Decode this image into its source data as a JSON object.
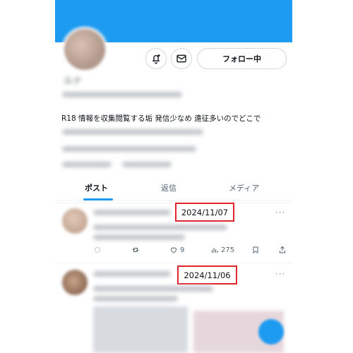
{
  "profile": {
    "display_name": "ルナ",
    "handle": "@lunaxxxx · Joined January 2020",
    "bio_line1": "R18 情報を収集閲覧する垢 発信少なめ 遠征多いのでどこで",
    "bio_line2": "もいるかも 気軽にどうぞ",
    "follow_label": "フォロー中"
  },
  "icons": {
    "notify": "bell-plus-icon",
    "message": "envelope-icon"
  },
  "tabs": [
    {
      "label": "ポスト",
      "active": true
    },
    {
      "label": "返信",
      "active": false
    },
    {
      "label": "メディア",
      "active": false
    }
  ],
  "posts": [
    {
      "date": "2024/11/07",
      "more": "···",
      "like_count": "9",
      "view_count": "275"
    },
    {
      "date": "2024/11/06",
      "more": "···"
    }
  ],
  "colors": {
    "accent": "#1d9bf0",
    "highlight_box": "#e0252c"
  }
}
